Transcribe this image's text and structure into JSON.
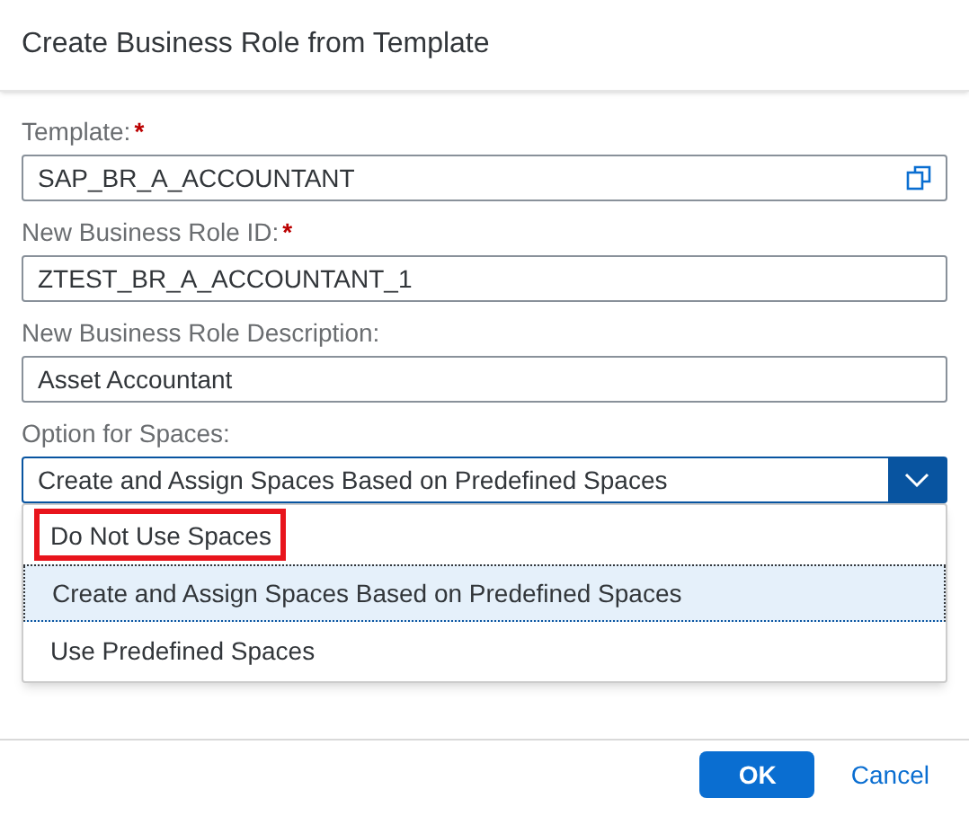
{
  "dialog": {
    "title": "Create Business Role from Template"
  },
  "fields": [
    {
      "label": "Template:",
      "required_mark": "*",
      "value": "SAP_BR_A_ACCOUNTANT",
      "kind": "value-help"
    },
    {
      "label": "New Business Role ID:",
      "required_mark": "*",
      "value": "ZTEST_BR_A_ACCOUNTANT_1",
      "kind": "text"
    },
    {
      "label": "New Business Role Description:",
      "value": "Asset Accountant",
      "kind": "text"
    }
  ],
  "spaces_select": {
    "label": "Option for Spaces:",
    "value": "Create and Assign Spaces Based on Predefined Spaces",
    "expanded": true,
    "options": [
      {
        "label": "Do Not Use Spaces",
        "selected": false,
        "highlighted": true
      },
      {
        "label": "Create and Assign Spaces Based on Predefined Spaces",
        "selected": true,
        "highlighted": false
      },
      {
        "label": "Use Predefined Spaces",
        "selected": false,
        "highlighted": false
      }
    ]
  },
  "buttons": [
    {
      "label": "OK",
      "kind": "primary"
    },
    {
      "label": "Cancel",
      "kind": "link"
    }
  ]
}
